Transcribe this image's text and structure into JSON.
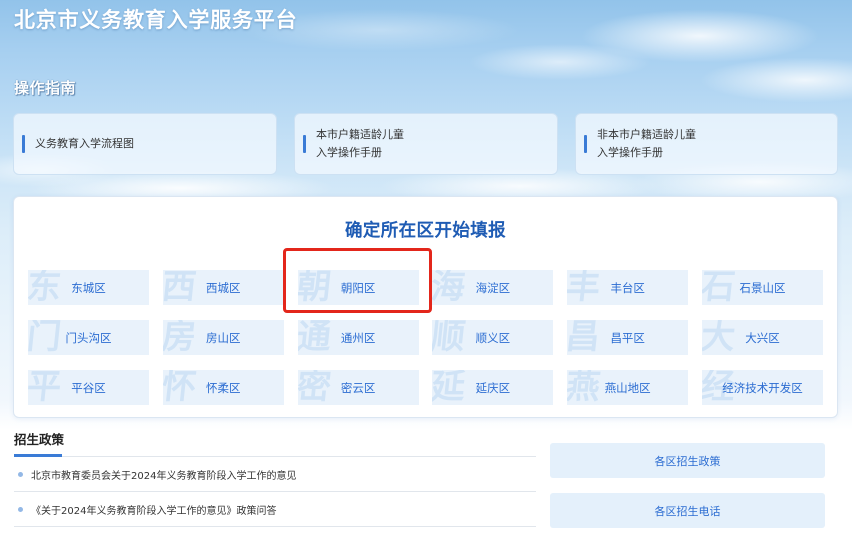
{
  "header": {
    "title": "北京市义务教育入学服务平台"
  },
  "guide": {
    "title": "操作指南",
    "cards": [
      {
        "lines": [
          "义务教育入学流程图"
        ]
      },
      {
        "lines": [
          "本市户籍适龄儿童",
          "入学操作手册"
        ]
      },
      {
        "lines": [
          "非本市户籍适龄儿童",
          "入学操作手册"
        ]
      }
    ]
  },
  "district_panel": {
    "title": "确定所在区开始填报",
    "districts": [
      {
        "label": "东城区",
        "watermark": "东"
      },
      {
        "label": "西城区",
        "watermark": "西"
      },
      {
        "label": "朝阳区",
        "watermark": "朝",
        "highlighted": true
      },
      {
        "label": "海淀区",
        "watermark": "海"
      },
      {
        "label": "丰台区",
        "watermark": "丰"
      },
      {
        "label": "石景山区",
        "watermark": "石"
      },
      {
        "label": "门头沟区",
        "watermark": "门"
      },
      {
        "label": "房山区",
        "watermark": "房"
      },
      {
        "label": "通州区",
        "watermark": "通"
      },
      {
        "label": "顺义区",
        "watermark": "顺"
      },
      {
        "label": "昌平区",
        "watermark": "昌"
      },
      {
        "label": "大兴区",
        "watermark": "大"
      },
      {
        "label": "平谷区",
        "watermark": "平"
      },
      {
        "label": "怀柔区",
        "watermark": "怀"
      },
      {
        "label": "密云区",
        "watermark": "密"
      },
      {
        "label": "延庆区",
        "watermark": "延"
      },
      {
        "label": "燕山地区",
        "watermark": "燕"
      },
      {
        "label": "经济技术开发区",
        "watermark": "经"
      }
    ]
  },
  "policy": {
    "title": "招生政策",
    "items": [
      "北京市教育委员会关于2024年义务教育阶段入学工作的意见",
      "《关于2024年义务教育阶段入学工作的意见》政策问答"
    ]
  },
  "quick_links": [
    {
      "label": "各区招生政策"
    },
    {
      "label": "各区招生电话"
    }
  ],
  "colors": {
    "brand_blue": "#2c6dd2",
    "title_blue": "#1f5cb4",
    "highlight_red": "#e3261b",
    "tile_bg": "#e9f2fb",
    "watermark": "#d0e3f6",
    "accent_bar": "#3a7bd6"
  }
}
